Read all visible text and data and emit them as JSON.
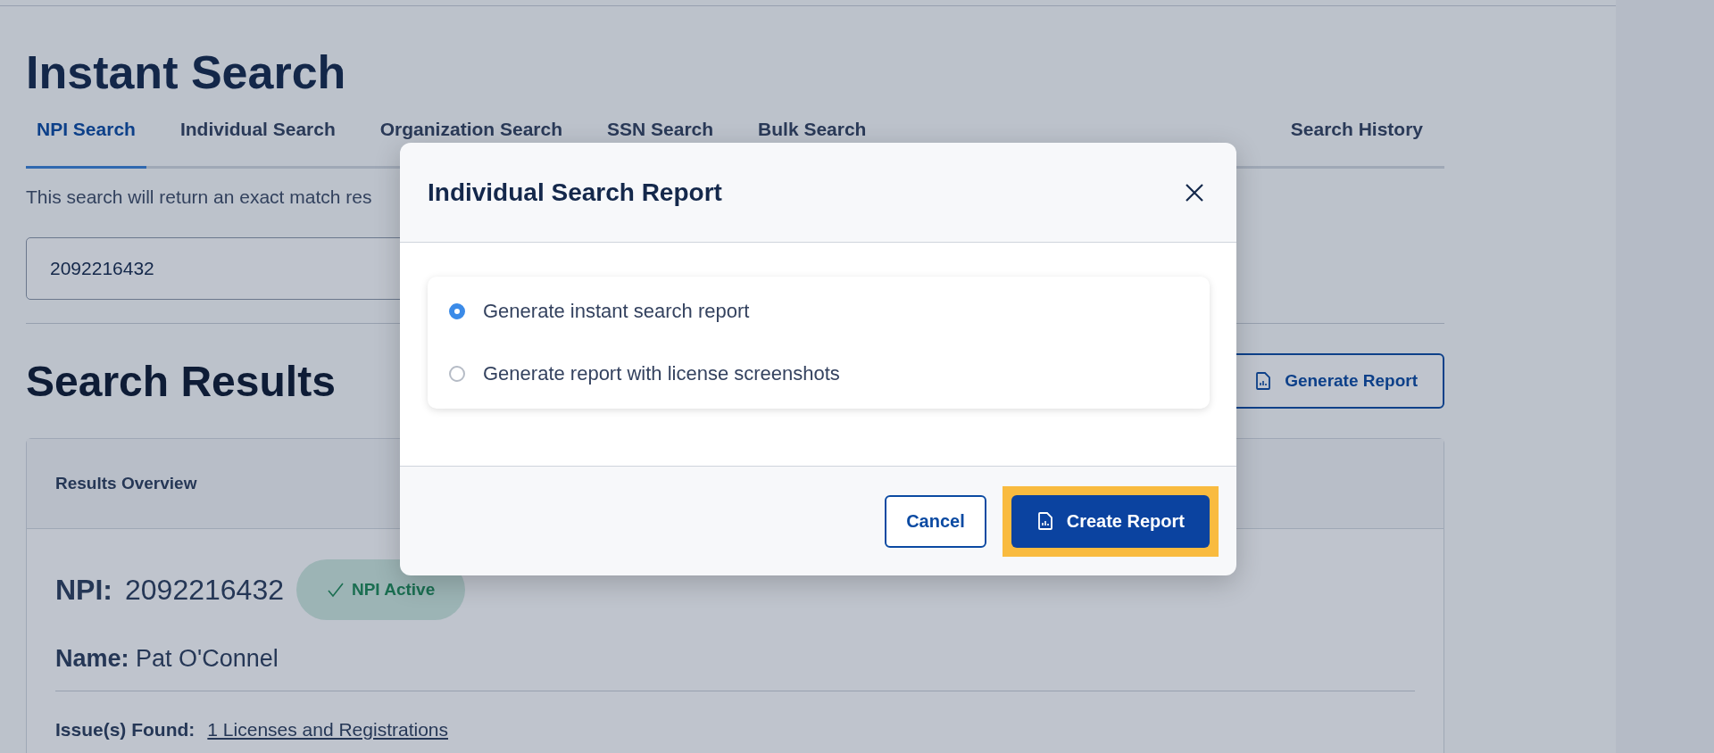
{
  "page": {
    "title": "Instant Search",
    "tabs": [
      {
        "label": "NPI Search",
        "selected": true
      },
      {
        "label": "Individual Search",
        "selected": false
      },
      {
        "label": "Organization Search",
        "selected": false
      },
      {
        "label": "SSN Search",
        "selected": false
      },
      {
        "label": "Bulk Search",
        "selected": false
      }
    ],
    "side_tab": "Search History",
    "description": "This search will return an exact match res",
    "search_field": {
      "value": "2092216432"
    },
    "results": {
      "title": "Search Results",
      "generate_button": "Generate Report",
      "card": {
        "title": "Results Overview",
        "npi_label": "NPI:",
        "npi_value": "2092216432",
        "badge": "NPI Active",
        "name_label": "Name:",
        "name_value": "Pat O'Connel",
        "issues_label": "Issue(s) Found:",
        "issues_link": "1 Licenses and Registrations"
      }
    }
  },
  "dialog": {
    "title": "Individual Search Report",
    "options": [
      {
        "label": "Generate instant search report",
        "selected": true
      },
      {
        "label": "Generate report with license screenshots",
        "selected": false
      }
    ],
    "buttons": [
      {
        "label": "Cancel",
        "kind": "secondary",
        "highlighted": false
      },
      {
        "label": "Create Report",
        "kind": "primary",
        "highlighted": true
      }
    ]
  }
}
